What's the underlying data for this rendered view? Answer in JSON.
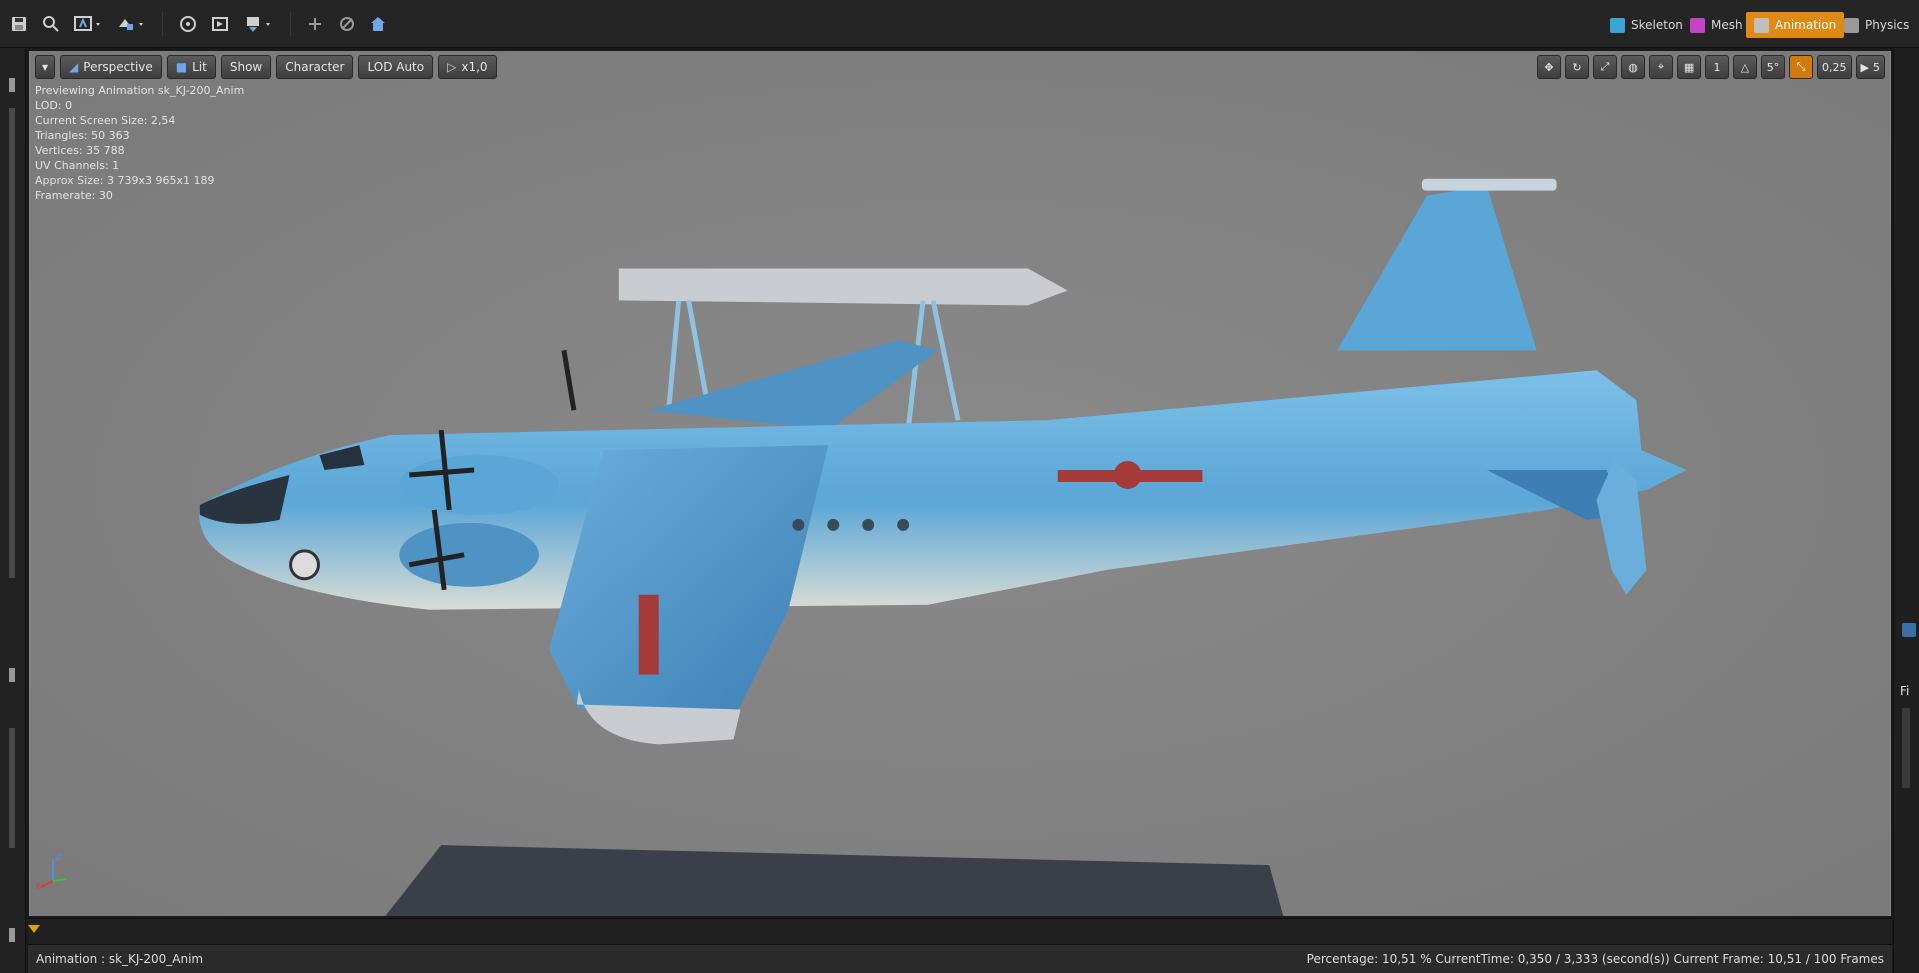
{
  "toolbar": {
    "icons": [
      "save-icon",
      "find-in-browser-icon",
      "create-asset-icon",
      "reimport-icon",
      "preview-mesh-icon",
      "animation-tools-icon",
      "record-icon",
      "add-icon",
      "apply-icon",
      "home-icon"
    ]
  },
  "modes": {
    "items": [
      {
        "label": "Skeleton",
        "color": "#3aa3d8"
      },
      {
        "label": "Mesh",
        "color": "#c642c6"
      },
      {
        "label": "Animation",
        "color": "#a9a9a9"
      },
      {
        "label": "Physics",
        "color": "#9a9a9a"
      }
    ],
    "active": "Animation",
    "active_color": "#e08a16"
  },
  "viewport_toolbar": {
    "perspective": "Perspective",
    "lit": "Lit",
    "show": "Show",
    "character": "Character",
    "lod": "LOD Auto",
    "speed": "x1,0"
  },
  "viewport_tools": {
    "grid_snap": "1",
    "rot_snap": "5°",
    "scale_value": "0,25",
    "camera_speed": "5"
  },
  "info": {
    "line1": "Previewing Animation sk_KJ-200_Anim",
    "line2": "LOD: 0",
    "line3": "Current Screen Size: 2,54",
    "line4": "Triangles: 50 363",
    "line5": "Vertices: 35 788",
    "line6": "UV Channels: 1",
    "line7": "Approx Size: 3 739x3 965x1 189",
    "line8": "Framerate: 30"
  },
  "status": {
    "animation": "Animation :  sk_KJ-200_Anim",
    "details": "Percentage:  10,51 %  CurrentTime:  0,350 / 3,333 (second(s))  Current Frame:  10,51 / 100 Frames"
  },
  "right_dock": {
    "label": "Fi"
  },
  "colors": {
    "viewport_bg": "#828282",
    "aircraft_blue": "#5aa6d6",
    "floor": "#3a3f4a"
  }
}
